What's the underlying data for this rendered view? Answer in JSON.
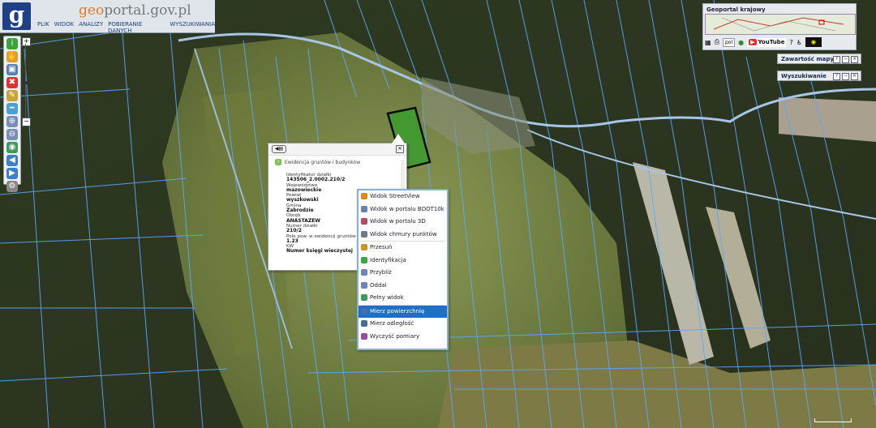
{
  "header": {
    "logo_letter": "g",
    "site_prefix": "geo",
    "site_suffix": "portal.gov.pl",
    "menu": [
      "PLIK",
      "WIDOK",
      "ANALIZY",
      "POBIERANIE DANYCH",
      "WYSZUKIWANIA"
    ]
  },
  "zoom": {
    "plus": "+",
    "minus": "−"
  },
  "popup": {
    "title": "Ewidencja gruntów i budynków",
    "fields": [
      {
        "label": "Identyfikator działki",
        "value": "143506_2.0002.210/2"
      },
      {
        "label": "Województwo",
        "value": "mazowieckie"
      },
      {
        "label": "Powiat",
        "value": "wyszkowski"
      },
      {
        "label": "Gmina",
        "value": "Zabrodzie"
      },
      {
        "label": "Obręb",
        "value": "ANASTAZEW"
      },
      {
        "label": "Numer działki",
        "value": "210/2"
      },
      {
        "label": "Pole pow. w ewidencji gruntów",
        "value": "1.23"
      },
      {
        "label": "KW",
        "value": "Numer księgi wieczystej"
      }
    ]
  },
  "context_menu": [
    {
      "label": "Widok StreetView",
      "icon": "streetview-icon",
      "color": "#e08a1e"
    },
    {
      "label": "Widok w portalu BDOT10k",
      "icon": "bdot-icon",
      "color": "#6a7fb8"
    },
    {
      "label": "Widok w portalu 3D",
      "icon": "3d-icon",
      "color": "#b8486a"
    },
    {
      "label": "Widok chmury punktów",
      "icon": "pointcloud-icon",
      "color": "#6e7a88"
    },
    {
      "label": "Przesuń",
      "icon": "pan-icon",
      "color": "#d0932a"
    },
    {
      "label": "Identyfikacja",
      "icon": "identify-icon",
      "color": "#3aa63a"
    },
    {
      "label": "Przybliż",
      "icon": "zoom-in-icon",
      "color": "#6a86b8"
    },
    {
      "label": "Oddal",
      "icon": "zoom-out-icon",
      "color": "#6a86b8"
    },
    {
      "label": "Pełny widok",
      "icon": "full-view-icon",
      "color": "#3c9a5a"
    },
    {
      "label": "Mierz powierzchnię",
      "icon": "measure-area-icon",
      "color": "#3f6fb0",
      "selected": true
    },
    {
      "label": "Mierz odległość",
      "icon": "measure-distance-icon",
      "color": "#4a6a9a"
    },
    {
      "label": "Wyczyść pomiary",
      "icon": "clear-measure-icon",
      "color": "#9a4aa0"
    }
  ],
  "right": {
    "title": "Geoportal krajowy",
    "language": "pol",
    "youtube": "YouTube",
    "content_panel": "Zawartość mapy",
    "search_panel": "Wyszukiwanie"
  },
  "colors": {
    "parcel_line": "#5aa8ff",
    "road": "#a6c6e8",
    "selected_parcel": "#000000"
  }
}
